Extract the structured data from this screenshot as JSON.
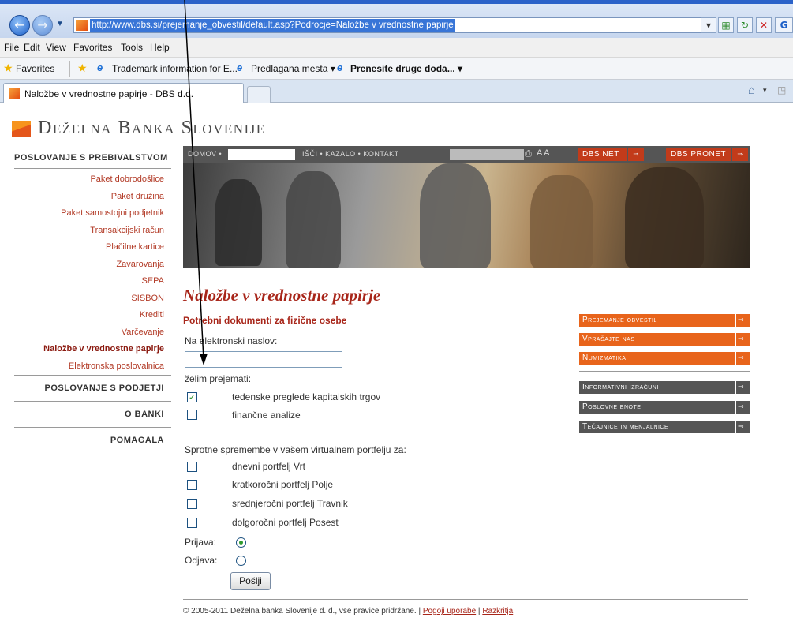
{
  "browser": {
    "url": "http://www.dbs.si/prejemanje_obvestil/default.asp?Podrocje=Naložbe v vrednostne papirje",
    "menu": [
      "File",
      "Edit",
      "View",
      "Favorites",
      "Tools",
      "Help"
    ],
    "favorites_label": "Favorites",
    "favorites": [
      "Trademark information for E...",
      "Predlagana mesta ▾",
      "Prenesite druge doda... ▾"
    ],
    "tab_title": "Naložbe v vrednostne papirje - DBS d.d."
  },
  "site": {
    "logo_first": "D",
    "logo_first_rest": "eželna ",
    "logo_second": "B",
    "logo_second_rest": "anka ",
    "logo_third": "S",
    "logo_third_rest": "lovenije"
  },
  "sidebar": {
    "section1": "Poslovanje s prebivalstvom",
    "items": [
      "Paket dobrodošlice",
      "Paket družina",
      "Paket samostojni podjetnik",
      "Transakcijski račun",
      "Plačilne kartice",
      "Zavarovanja",
      "SEPA",
      "SISBON",
      "Krediti",
      "Varčevanje",
      "Naložbe v vrednostne papirje",
      "Elektronska poslovalnica"
    ],
    "active_index": 10,
    "sections": [
      "Poslovanje s podjetji",
      "O banki",
      "Pomagala"
    ]
  },
  "topnav": {
    "home": "DOMOV •",
    "links": "IŠČI • KAZALO • KONTAKT",
    "font_toggle": "A A",
    "dbs_net": "DBS NET",
    "dbs_pronet": "DBS PRONET"
  },
  "main": {
    "title": "Naložbe v vrednostne papirje",
    "subtitle": "Potrebni dokumenti za fizične osebe",
    "email_label": "Na elektronski naslov:",
    "email_value": "",
    "want_label": "želim prejemati:",
    "options": [
      {
        "label": "tedenske preglede kapitalskih trgov",
        "checked": true
      },
      {
        "label": "finančne analize",
        "checked": false
      }
    ],
    "portfolio_label": "Sprotne spremembe v vašem virtualnem portfelju za:",
    "portfolios": [
      {
        "label": "dnevni portfelj Vrt",
        "checked": false
      },
      {
        "label": "kratkoročni portfelj Polje",
        "checked": false
      },
      {
        "label": "srednjeročni portfelj Travnik",
        "checked": false
      },
      {
        "label": "dolgoročni portfelj Posest",
        "checked": false
      }
    ],
    "subscribe_label": "Prijava:",
    "unsubscribe_label": "Odjava:",
    "subscribe_selected": true,
    "send_label": "Pošlji"
  },
  "right_links": {
    "orange": [
      "Prejemanje obvestil",
      "Vprašajte nas",
      "Numizmatika"
    ],
    "gray": [
      "Informativni izračuni",
      "Poslovne enote",
      "Tečajnice in menjalnice"
    ]
  },
  "footer": {
    "copyright": "© 2005-2011 Deželna banka Slovenije d. d., vse pravice pridržane. |",
    "link1": "Pogoji uporabe",
    "sep": "|",
    "link2": "Razkritja"
  },
  "colors": {
    "accent": "#a8261a",
    "orange": "#e8641b",
    "gray": "#555555"
  }
}
